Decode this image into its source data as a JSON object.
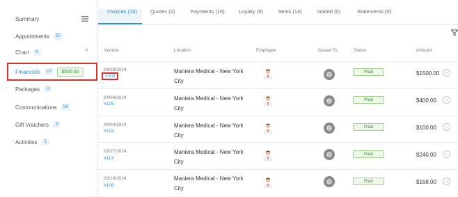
{
  "sidebar": {
    "summary": "Summary",
    "appointments": {
      "label": "Appointments",
      "count": "57"
    },
    "chart": {
      "label": "Chart",
      "count": "9"
    },
    "financials": {
      "label": "Financials",
      "count": "17",
      "amount": "$500.00"
    },
    "packages": {
      "label": "Packages",
      "count": "0"
    },
    "communications": {
      "label": "Communications",
      "count": "56"
    },
    "gift_vouchers": {
      "label": "Gift Vouchers",
      "count": "3"
    },
    "activities": {
      "label": "Activities",
      "count": "1"
    }
  },
  "tabs": [
    "Invoices (15)",
    "Quotes (2)",
    "Payments (16)",
    "Loyalty (6)",
    "Items (14)",
    "Voided (0)",
    "Statements (0)"
  ],
  "table": {
    "headers": [
      "Invoice",
      "Location",
      "Employee",
      "Issued To",
      "Status",
      "Amount"
    ],
    "rows": [
      {
        "date": "04/25/2024",
        "invoice": "#203",
        "location": "Maniera Medical - New York City",
        "status": "Paid",
        "amount": "$1500.00"
      },
      {
        "date": "04/04/2024",
        "invoice": "#125",
        "location": "Maniera Medical - New York City",
        "status": "Paid",
        "amount": "$400.00"
      },
      {
        "date": "04/04/2024",
        "invoice": "#124",
        "location": "Maniera Medical - New York City",
        "status": "Paid",
        "amount": "$100.00"
      },
      {
        "date": "03/27/2024",
        "invoice": "#113",
        "location": "Maniera Medical - New York City",
        "status": "Paid",
        "amount": "$240.00"
      },
      {
        "date": "03/19/2024",
        "invoice": "#108",
        "location": "Maniera Medical - New York City",
        "status": "Paid",
        "amount": "$168.00"
      }
    ]
  },
  "colors": {
    "accent": "#2d8fc9",
    "highlight_outline": "#d9302b",
    "paid_green": "#3c8b3c"
  },
  "icons": {
    "summary": "list-icon",
    "chart": "chevron-right-icon",
    "filter": "filter-icon",
    "issued": "globe-icon",
    "row_menu": "more-icon",
    "employee": "avatar"
  }
}
